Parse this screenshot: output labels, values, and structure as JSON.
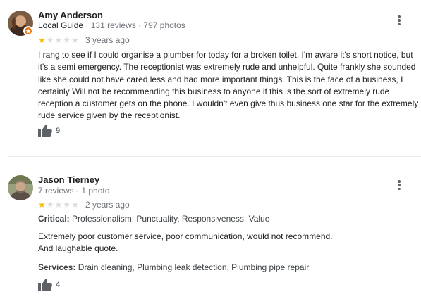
{
  "reviews": [
    {
      "name": "Amy Anderson",
      "local_guide": "Local Guide",
      "review_count": "131 reviews",
      "separator": " · ",
      "photo_count": "797 photos",
      "rating": 1,
      "rating_max": 5,
      "date": "3 years ago",
      "text": "I rang to see if I could organise a plumber for today for a broken toilet.  I'm aware it's short notice, but it's a semi emergency. The receptionist was extremely rude and unhelpful.  Quite frankly she sounded like she could not have cared less and had more important things.  This is the face of a business, I certainly Will not be recommending this business to anyone if this is the sort of extremely rude reception a customer gets on the phone.  I wouldn't even give thus business one star for the extremely rude service given by the receptionist.",
      "likes": "9"
    },
    {
      "name": "Jason Tierney",
      "review_count": "7 reviews",
      "separator": " · ",
      "photo_count": "1 photo",
      "rating": 1,
      "rating_max": 5,
      "date": "2 years ago",
      "critical_label": "Critical:",
      "critical_value": "Professionalism, Punctuality, Responsiveness, Value",
      "text_line1": "Extremely poor customer service, poor communication, would not recommend.",
      "text_line2": "And laughable quote.",
      "services_label": "Services:",
      "services_value": "Drain cleaning, Plumbing leak detection, Plumbing pipe repair",
      "likes": "4"
    }
  ],
  "colors": {
    "star_filled": "#fbbc04",
    "star_empty": "#dadce0",
    "badge": "#e8710a",
    "meta_text": "#70757a"
  },
  "icons": [
    "local-guide-badge-icon",
    "star-icon",
    "more-options-icon",
    "thumbs-up-icon"
  ]
}
